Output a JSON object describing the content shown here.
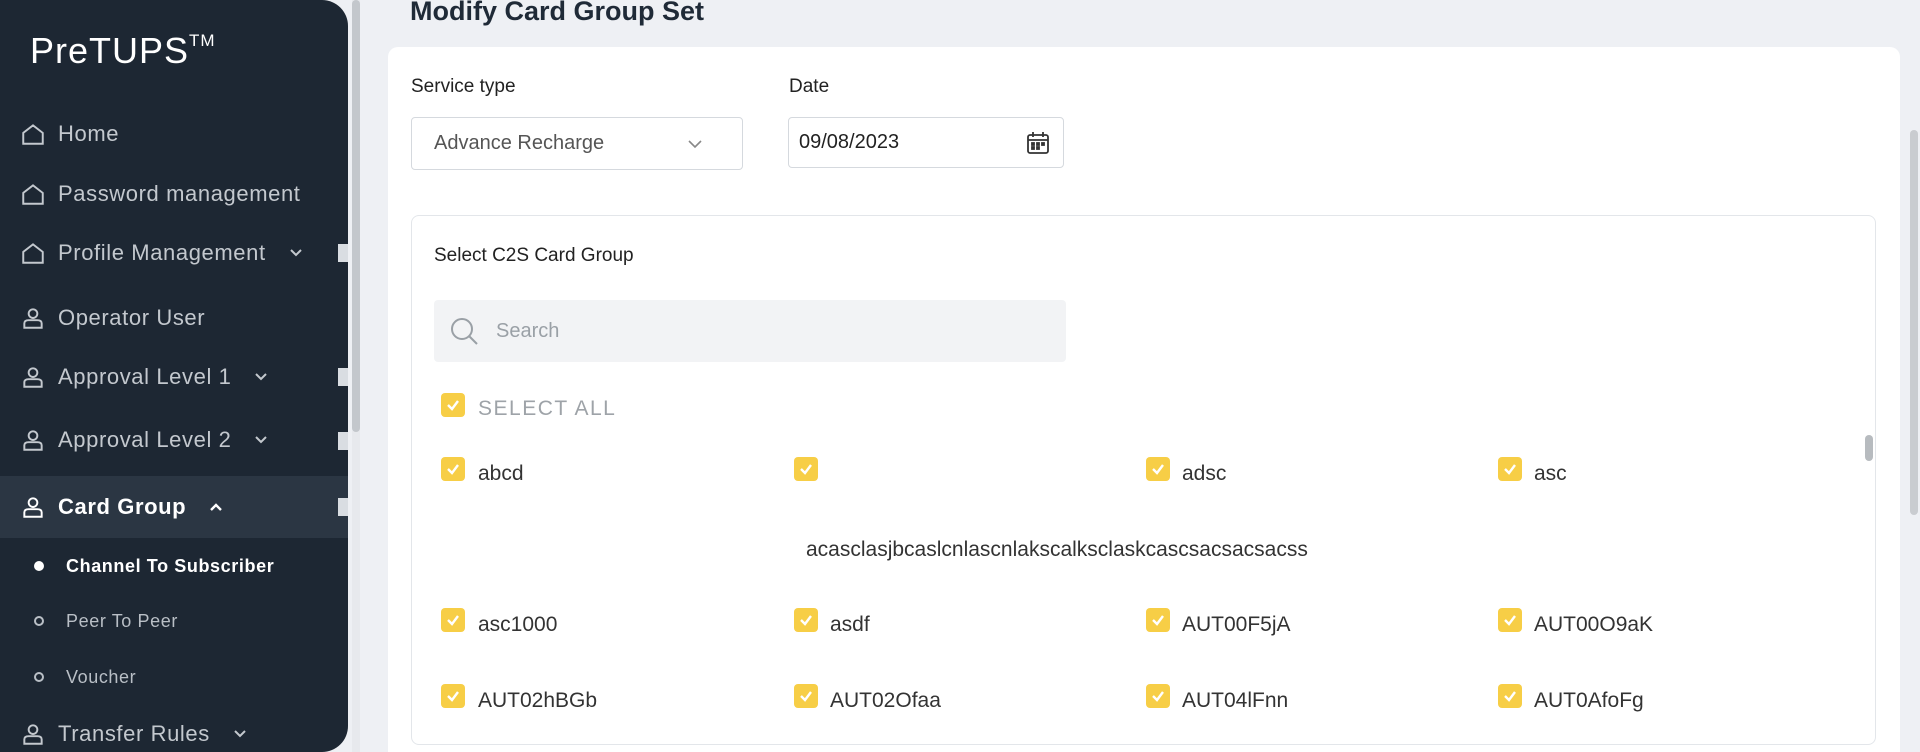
{
  "brand": {
    "name": "PreTUPS",
    "tm": "TM"
  },
  "sidebar": {
    "items": [
      {
        "label": "Home",
        "icon": "home-icon"
      },
      {
        "label": "Password management",
        "icon": "home-icon"
      },
      {
        "label": "Profile Management",
        "icon": "home-icon"
      },
      {
        "label": "Operator User",
        "icon": "user-icon"
      },
      {
        "label": "Approval Level 1",
        "icon": "user-icon"
      },
      {
        "label": "Approval Level 2",
        "icon": "user-icon"
      },
      {
        "label": "Card Group",
        "icon": "user-icon"
      },
      {
        "label": "Transfer Rules",
        "icon": "user-icon"
      }
    ],
    "sub_items": [
      {
        "label": "Channel To Subscriber",
        "active": true
      },
      {
        "label": "Peer To Peer",
        "active": false
      },
      {
        "label": "Voucher",
        "active": false
      }
    ]
  },
  "page": {
    "title": "Modify Card Group Set"
  },
  "form": {
    "service_type_label": "Service type",
    "service_type_value": "Advance Recharge",
    "date_label": "Date",
    "date_value": "09/08/2023"
  },
  "card_group": {
    "title": "Select C2S Card Group",
    "search_placeholder": "Search",
    "select_all_label": "SELECT ALL",
    "items": [
      "abcd",
      "acasclasjbcaslcnlascnlakscalksclaskcascsacsacsacss",
      "adsc",
      "asc",
      "asc1000",
      "asdf",
      "AUT00F5jA",
      "AUT00O9aK",
      "AUT02hBGb",
      "AUT02Ofaa",
      "AUT04lFnn",
      "AUT0AfoFg"
    ]
  },
  "colors": {
    "sidebar_bg": "#1d2733",
    "checkbox": "#f7ce46",
    "page_bg": "#eef0f4"
  }
}
